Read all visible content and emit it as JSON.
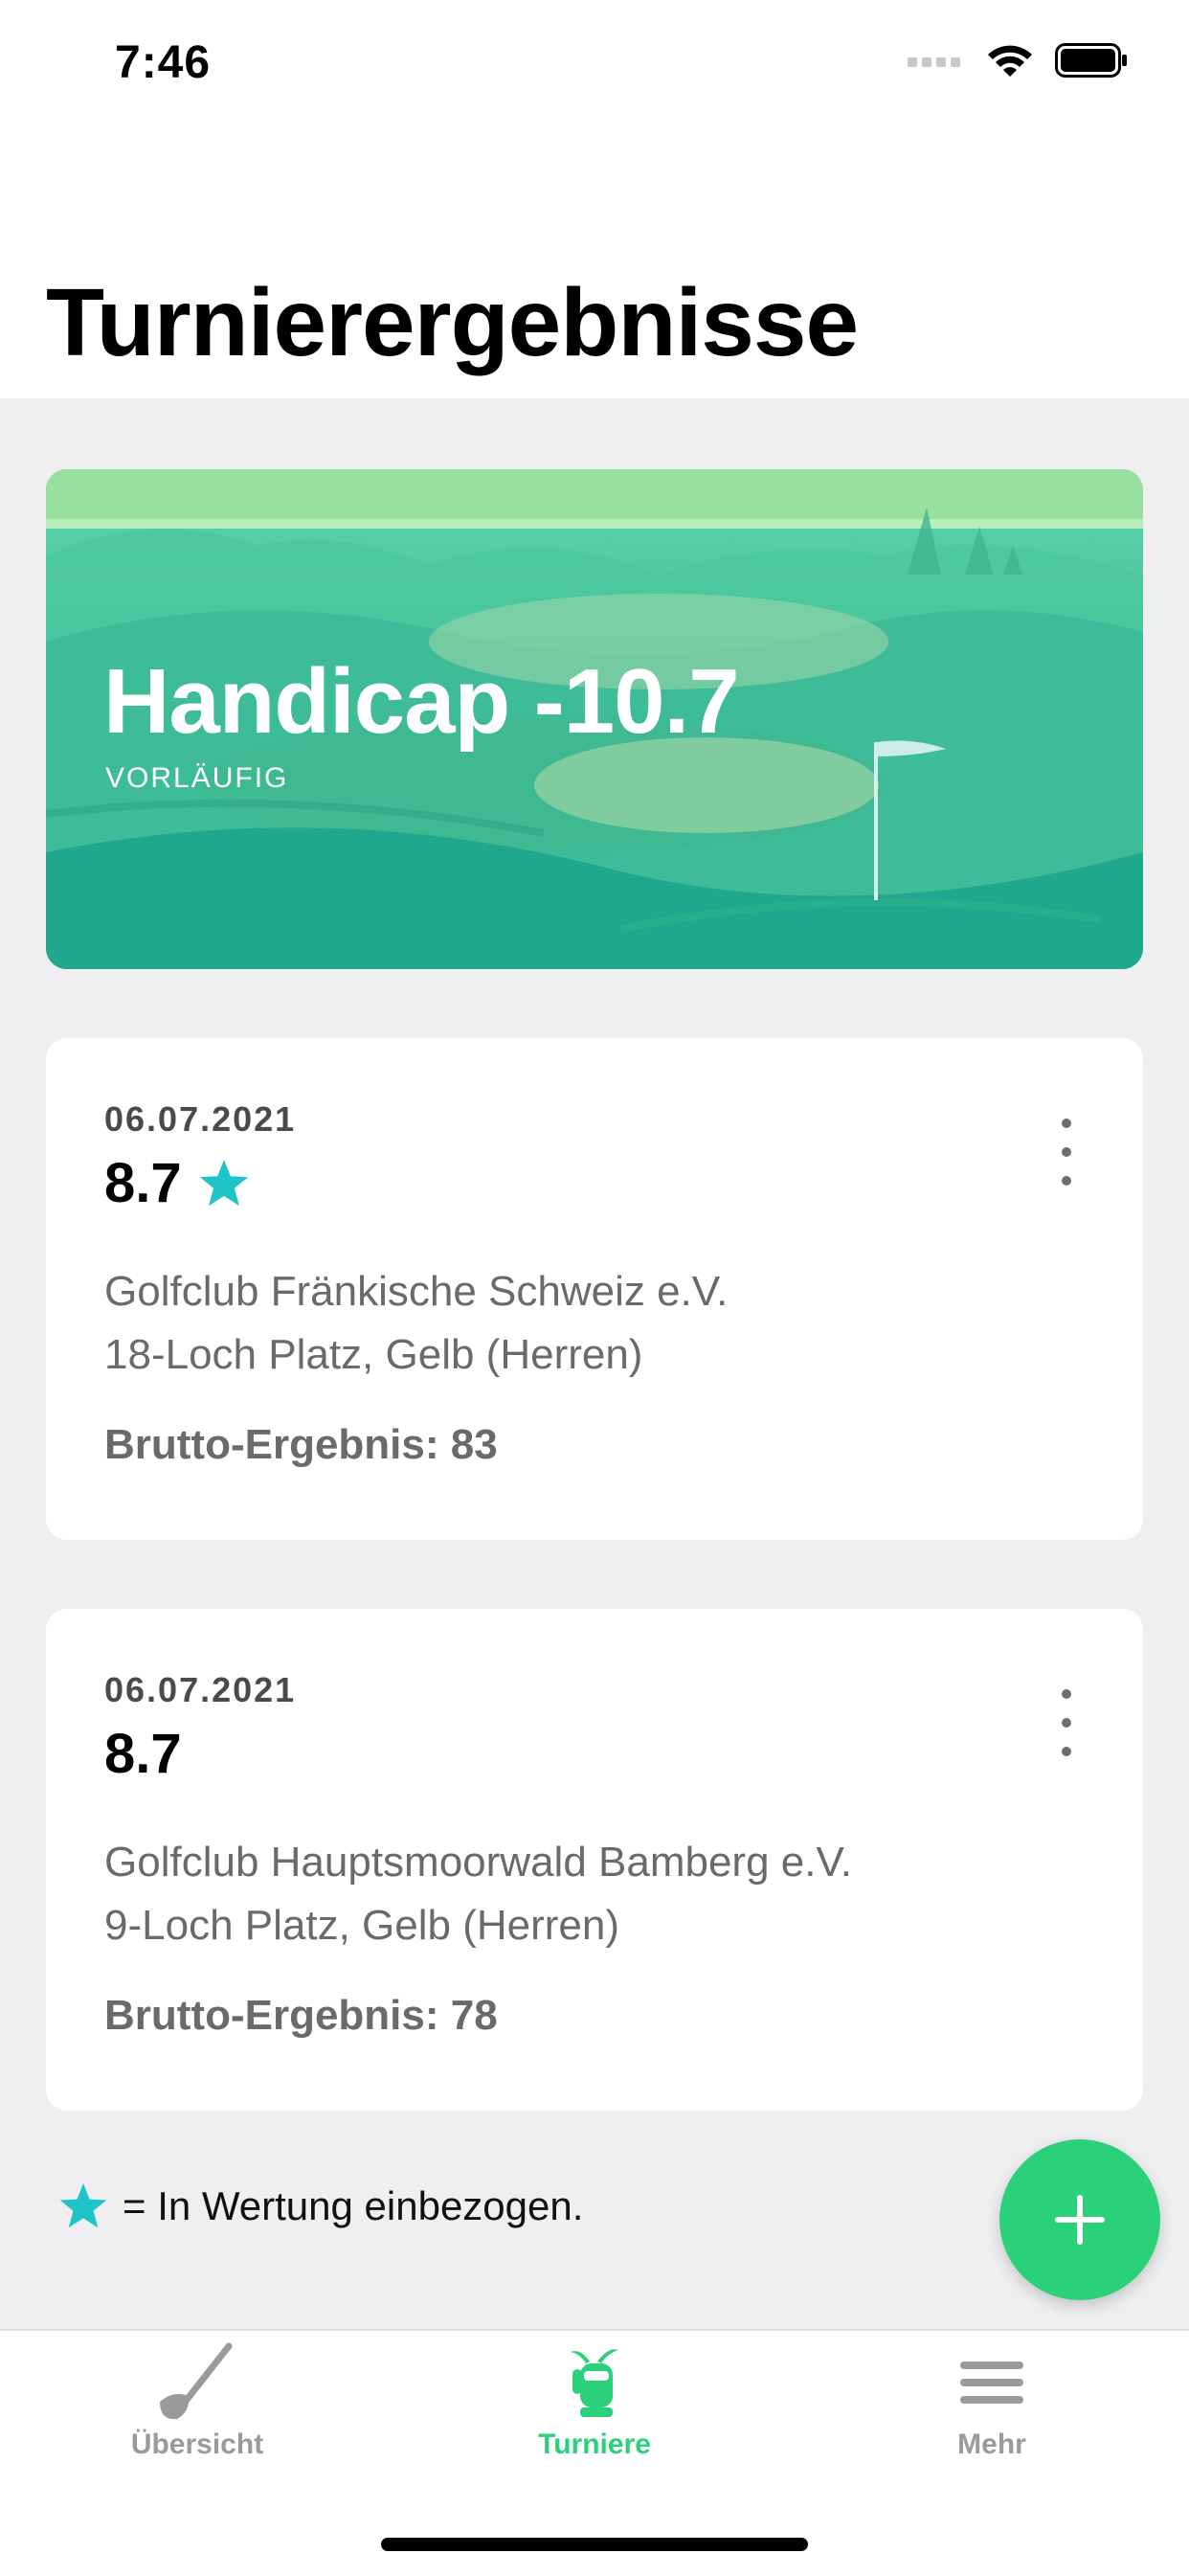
{
  "status_bar": {
    "time": "7:46"
  },
  "header": {
    "title": "Turnierergebnisse"
  },
  "handicap_card": {
    "title": "Handicap -10.7",
    "subtitle": "VORLÄUFIG"
  },
  "results": [
    {
      "date": "06.07.2021",
      "score": "8.7",
      "counted": true,
      "club": "Golfclub Fränkische Schweiz e.V.",
      "course": "18-Loch Platz, Gelb (Herren)",
      "gross": "Brutto-Ergebnis: 83"
    },
    {
      "date": "06.07.2021",
      "score": "8.7",
      "counted": false,
      "club": "Golfclub Hauptsmoorwald Bamberg e.V.",
      "course": "9-Loch Platz, Gelb (Herren)",
      "gross": "Brutto-Ergebnis: 78"
    }
  ],
  "legend": {
    "text": "= In Wertung einbezogen."
  },
  "tabs": [
    {
      "label": "Übersicht",
      "icon": "golf-club-icon",
      "active": false
    },
    {
      "label": "Turniere",
      "icon": "golf-bag-icon",
      "active": true
    },
    {
      "label": "Mehr",
      "icon": "menu-icon",
      "active": false
    }
  ],
  "colors": {
    "accent_green": "#2bd17a",
    "star_teal": "#1fc4c8",
    "background": "#efeff1"
  }
}
